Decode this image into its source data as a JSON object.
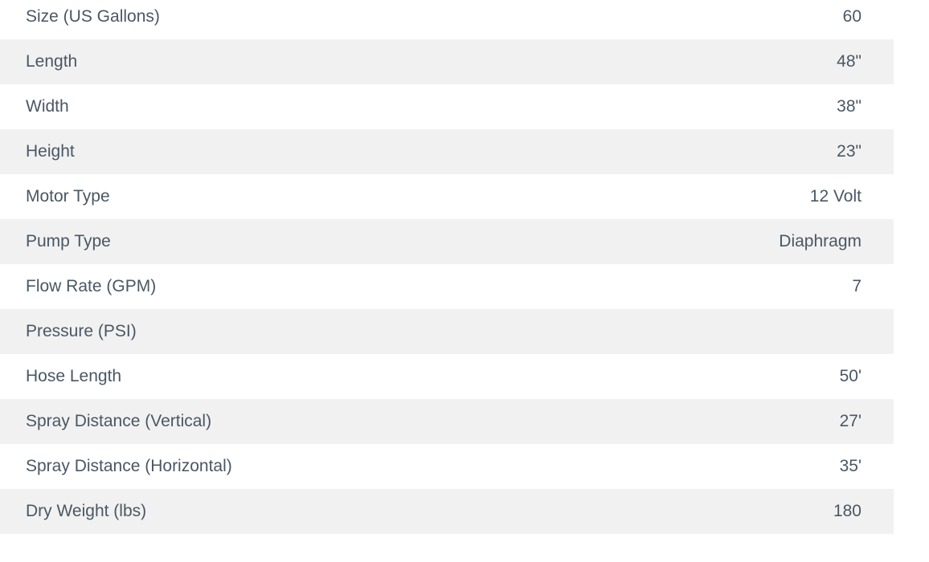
{
  "colors": {
    "text": "#4a5764",
    "row_background": "#ffffff",
    "row_background_striped": "#f1f1f1"
  },
  "spec_table": {
    "rows": [
      {
        "label": "Size (US Gallons)",
        "value": "60"
      },
      {
        "label": "Length",
        "value": "48\""
      },
      {
        "label": "Width",
        "value": "38\""
      },
      {
        "label": "Height",
        "value": "23\""
      },
      {
        "label": "Motor Type",
        "value": "12 Volt"
      },
      {
        "label": "Pump Type",
        "value": "Diaphragm"
      },
      {
        "label": "Flow Rate (GPM)",
        "value": "7"
      },
      {
        "label": "Pressure (PSI)",
        "value": ""
      },
      {
        "label": "Hose Length",
        "value": "50'"
      },
      {
        "label": "Spray Distance (Vertical)",
        "value": "27'"
      },
      {
        "label": "Spray Distance (Horizontal)",
        "value": "35'"
      },
      {
        "label": "Dry Weight (lbs)",
        "value": "180"
      }
    ]
  }
}
